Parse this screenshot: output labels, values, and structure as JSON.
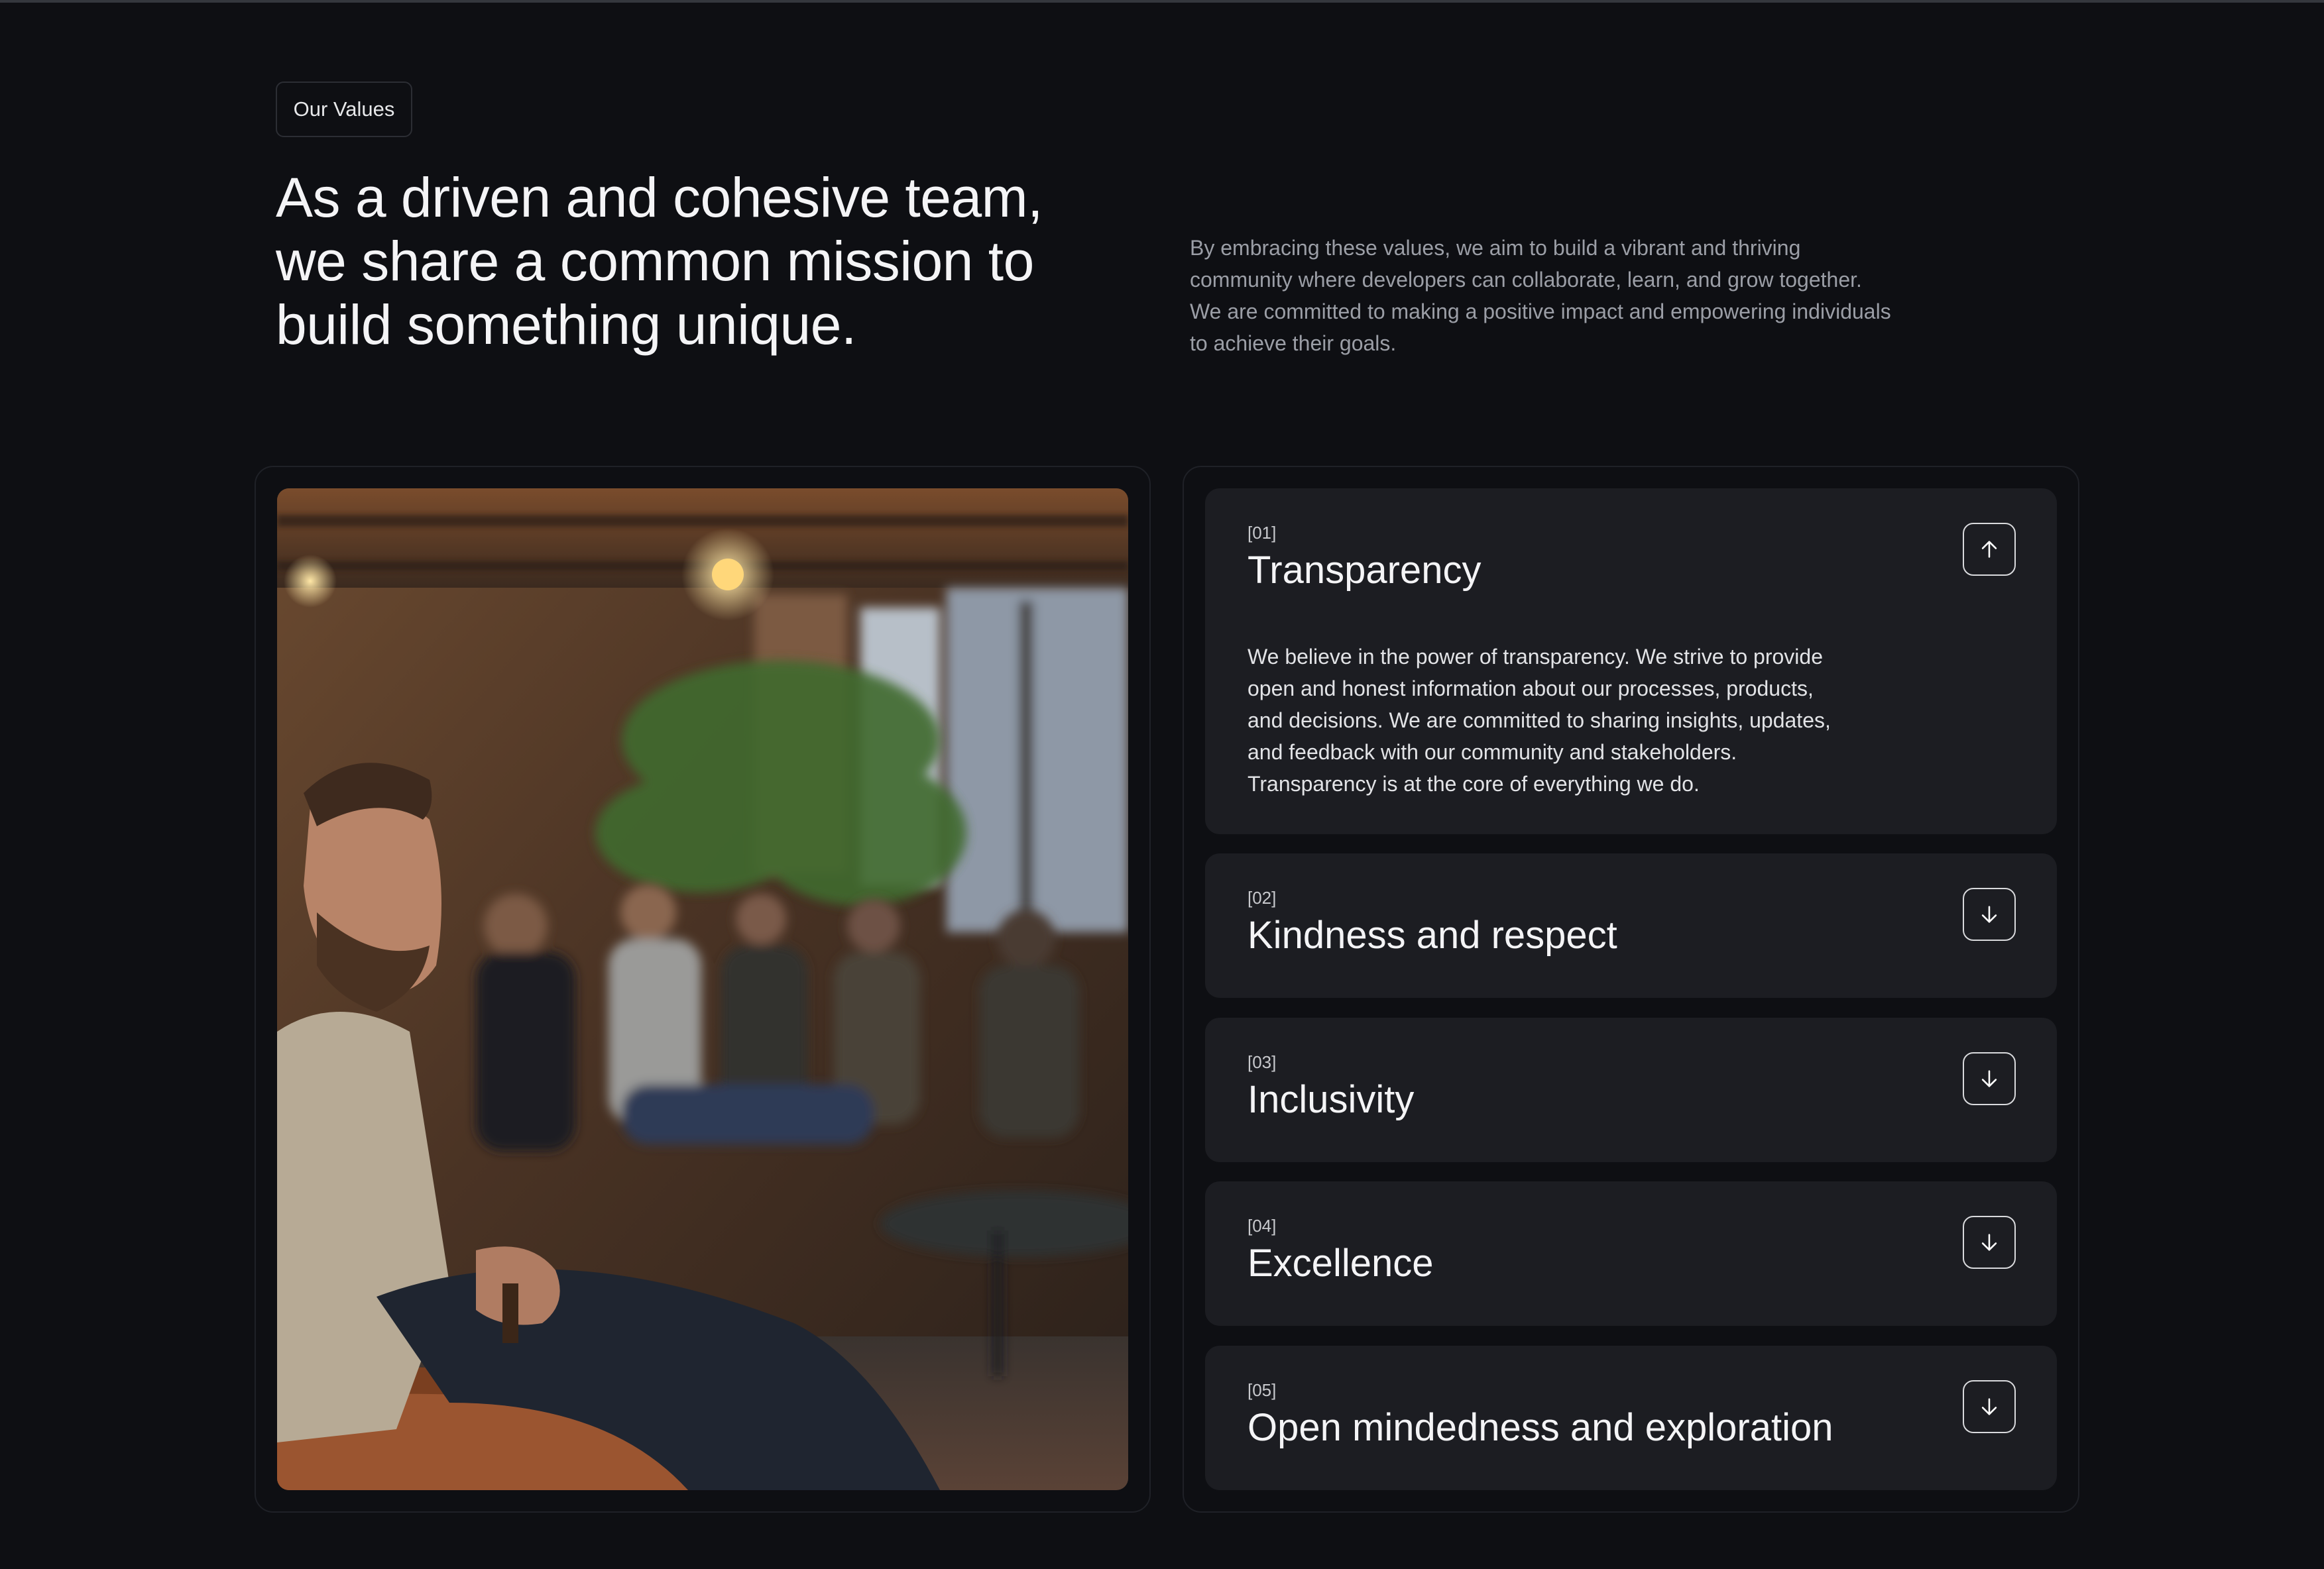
{
  "section": {
    "badge": "Our Values",
    "headline": "As a driven and cohesive team, we share a common mission to build something unique.",
    "intro": "By embracing these values, we aim to build a vibrant and thriving community where developers can collaborate, learn, and grow together. We are committed to making a positive impact and empowering individuals to achieve their goals."
  },
  "photo": {
    "alt": "Group of people seated in a warm loft space listening attentively"
  },
  "values": [
    {
      "number": "[01]",
      "title": "Transparency",
      "expanded": true,
      "icon": "arrow-up-icon",
      "body": "We believe in the power of transparency. We strive to provide open and honest information about our processes, products, and decisions. We are committed to sharing insights, updates, and feedback with our community and stakeholders. Transparency is at the core of everything we do."
    },
    {
      "number": "[02]",
      "title": "Kindness and respect",
      "expanded": false,
      "icon": "arrow-down-icon"
    },
    {
      "number": "[03]",
      "title": "Inclusivity",
      "expanded": false,
      "icon": "arrow-down-icon"
    },
    {
      "number": "[04]",
      "title": "Excellence",
      "expanded": false,
      "icon": "arrow-down-icon"
    },
    {
      "number": "[05]",
      "title": "Open mindedness and exploration",
      "expanded": false,
      "icon": "arrow-down-icon"
    }
  ],
  "colors": {
    "background": "#0e0f13",
    "card": "#1c1d22",
    "text": "#f4f4f6",
    "muted": "#9b9ea6"
  }
}
